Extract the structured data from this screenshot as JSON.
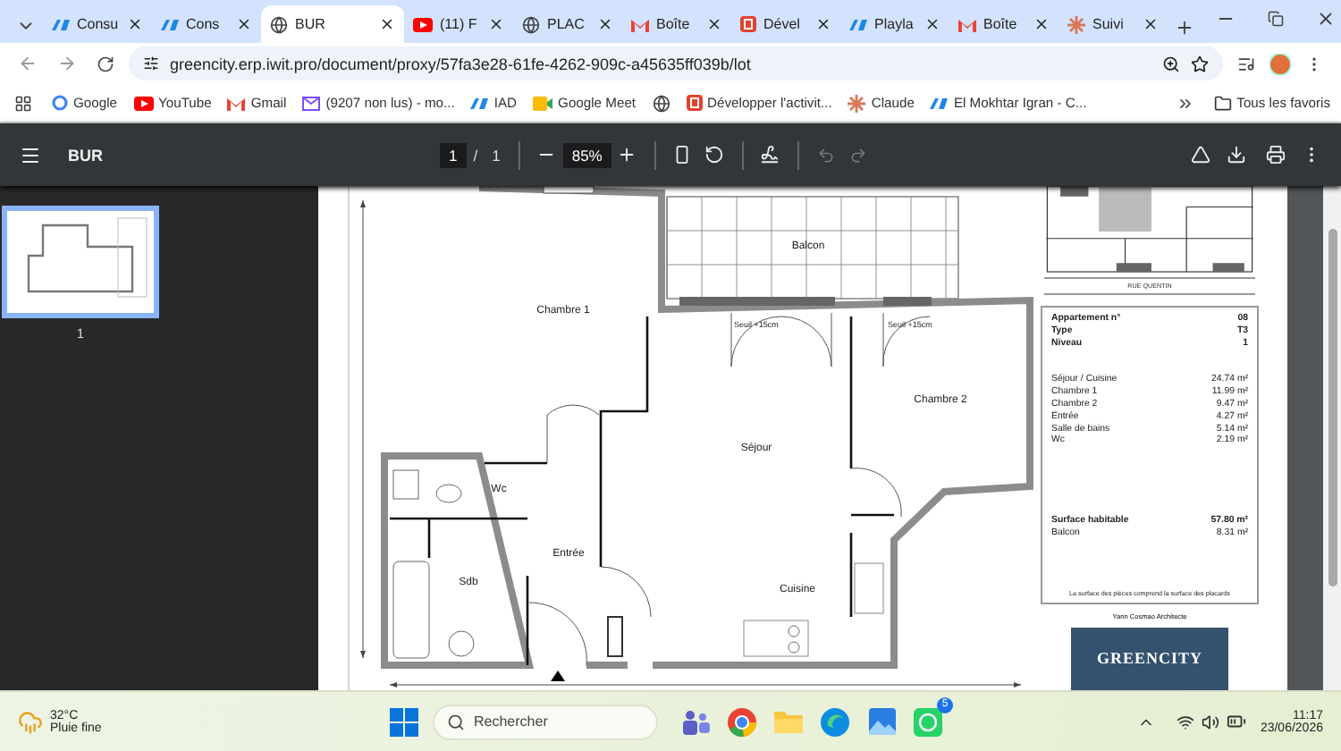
{
  "tabs": [
    {
      "kind": "iad",
      "label": "Consu",
      "selected": false
    },
    {
      "kind": "iad",
      "label": "Cons",
      "selected": false
    },
    {
      "kind": "globe",
      "label": "BUR",
      "selected": true
    },
    {
      "kind": "youtube",
      "label": "(11) F",
      "selected": false
    },
    {
      "kind": "globe",
      "label": "PLAC",
      "selected": false
    },
    {
      "kind": "gmail",
      "label": "Boîte",
      "selected": false
    },
    {
      "kind": "dev",
      "label": "Dével",
      "selected": false
    },
    {
      "kind": "iad",
      "label": "Playla",
      "selected": false
    },
    {
      "kind": "gmail",
      "label": "Boîte",
      "selected": false
    },
    {
      "kind": "claude",
      "label": "Suivi",
      "selected": false
    }
  ],
  "address": {
    "url": "greencity.erp.iwit.pro/document/proxy/57fa3e28-61fe-4262-909c-a45635ff039b/lot"
  },
  "bookmarks": [
    {
      "kind": "google",
      "label": "Google"
    },
    {
      "kind": "youtube",
      "label": "YouTube"
    },
    {
      "kind": "gmail",
      "label": "Gmail"
    },
    {
      "kind": "mail",
      "label": "(9207 non lus) - mo..."
    },
    {
      "kind": "iad",
      "label": "IAD"
    },
    {
      "kind": "meet",
      "label": "Google Meet"
    },
    {
      "kind": "globe"
    },
    {
      "kind": "dev",
      "label": "Développer l'activit..."
    },
    {
      "kind": "claude",
      "label": "Claude"
    },
    {
      "kind": "iad",
      "label": "El Mokhtar Igran - C..."
    }
  ],
  "all_bookmarks": "Tous les favoris",
  "pdf_toolbar": {
    "title": "BUR",
    "page": "1",
    "separator": "/",
    "page_count": "1",
    "zoom": "85%"
  },
  "thumbnails": [
    {
      "label": "1",
      "selected": true
    }
  ],
  "plan": {
    "rooms": [
      "Chambre 1",
      "Balcon",
      "Chambre 2",
      "Séjour",
      "Wc",
      "Entrée",
      "Sdb",
      "Cuisine"
    ],
    "thresholds": [
      "Seuil +15cm",
      "Seuil +15cm"
    ]
  },
  "key_plan": {
    "street": "RUE QUENTIN"
  },
  "summary": {
    "header": [
      {
        "label": "Appartement n°",
        "value": "08"
      },
      {
        "label": "Type",
        "value": "T3"
      },
      {
        "label": "Niveau",
        "value": "1"
      }
    ],
    "rooms": [
      {
        "label": "Séjour / Cuisine",
        "value": "24.74 m²"
      },
      {
        "label": "Chambre 1",
        "value": "11.99 m²"
      },
      {
        "label": "Chambre 2",
        "value": "9.47 m²"
      },
      {
        "label": "Entrée",
        "value": "4.27 m²"
      },
      {
        "label": "Salle de bains",
        "value": "5.14 m²"
      },
      {
        "label": "Wc",
        "value": "2.19 m²"
      }
    ],
    "totals": [
      {
        "label": "Surface habitable",
        "value": "57.80 m²",
        "bold": true
      },
      {
        "label": "Balcon",
        "value": "8.31 m²",
        "bold": false
      }
    ],
    "note": "La surface des pièces comprend la surface des placards"
  },
  "architect": "Yann Cosmao Architecte",
  "logo": "GREENCITY",
  "taskbar": {
    "temperature": "32°C",
    "weather": "Pluie fine",
    "search": {
      "placeholder": "Rechercher"
    },
    "apps": [
      {
        "kind": "teams"
      },
      {
        "kind": "chrome"
      },
      {
        "kind": "files"
      },
      {
        "kind": "edge"
      },
      {
        "kind": "photos"
      },
      {
        "kind": "whatsapp",
        "badge": "5"
      }
    ],
    "time": "11:17",
    "date": "23/06/2026"
  }
}
